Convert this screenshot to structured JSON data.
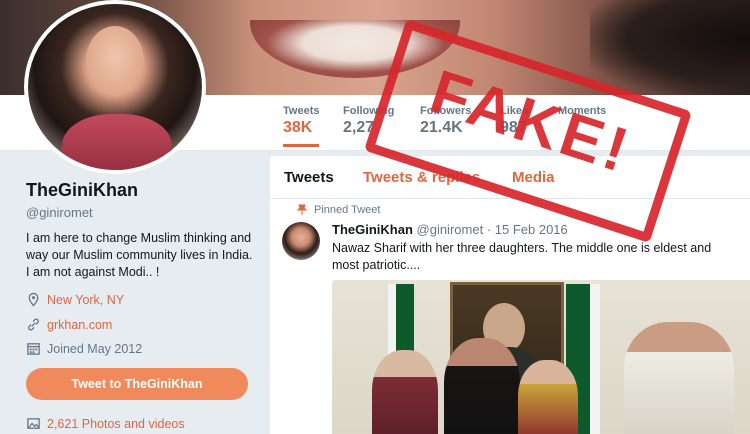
{
  "profile": {
    "name": "TheGiniKhan",
    "handle": "@giniromet",
    "bio": "I am here to change Muslim thinking and way our Muslim community lives in India. I am not against Modi.. !",
    "location": "New York, NY",
    "website": "grkhan.com",
    "joined": "Joined May 2012",
    "tweet_button": "Tweet to TheGiniKhan",
    "photos": "2,621 Photos and videos"
  },
  "stats": [
    {
      "label": "Tweets",
      "value": "38K"
    },
    {
      "label": "Following",
      "value": "2,27"
    },
    {
      "label": "Followers",
      "value": "21.4K"
    },
    {
      "label": "Likes",
      "value": "987"
    },
    {
      "label": "Moments",
      "value": ""
    }
  ],
  "tabs": [
    {
      "label": "Tweets"
    },
    {
      "label": "Tweets & replies"
    },
    {
      "label": "Media"
    }
  ],
  "tweet": {
    "pinned": "Pinned Tweet",
    "name": "TheGiniKhan",
    "handle": "@giniromet",
    "date": "· 15 Feb 2016",
    "text": "Nawaz Sharif with her three daughters. The middle one is eldest and most patriotic...."
  },
  "stamp": {
    "text": "FAKE!"
  },
  "colors": {
    "accent": "#e0663f",
    "stamp": "#d7262b"
  }
}
